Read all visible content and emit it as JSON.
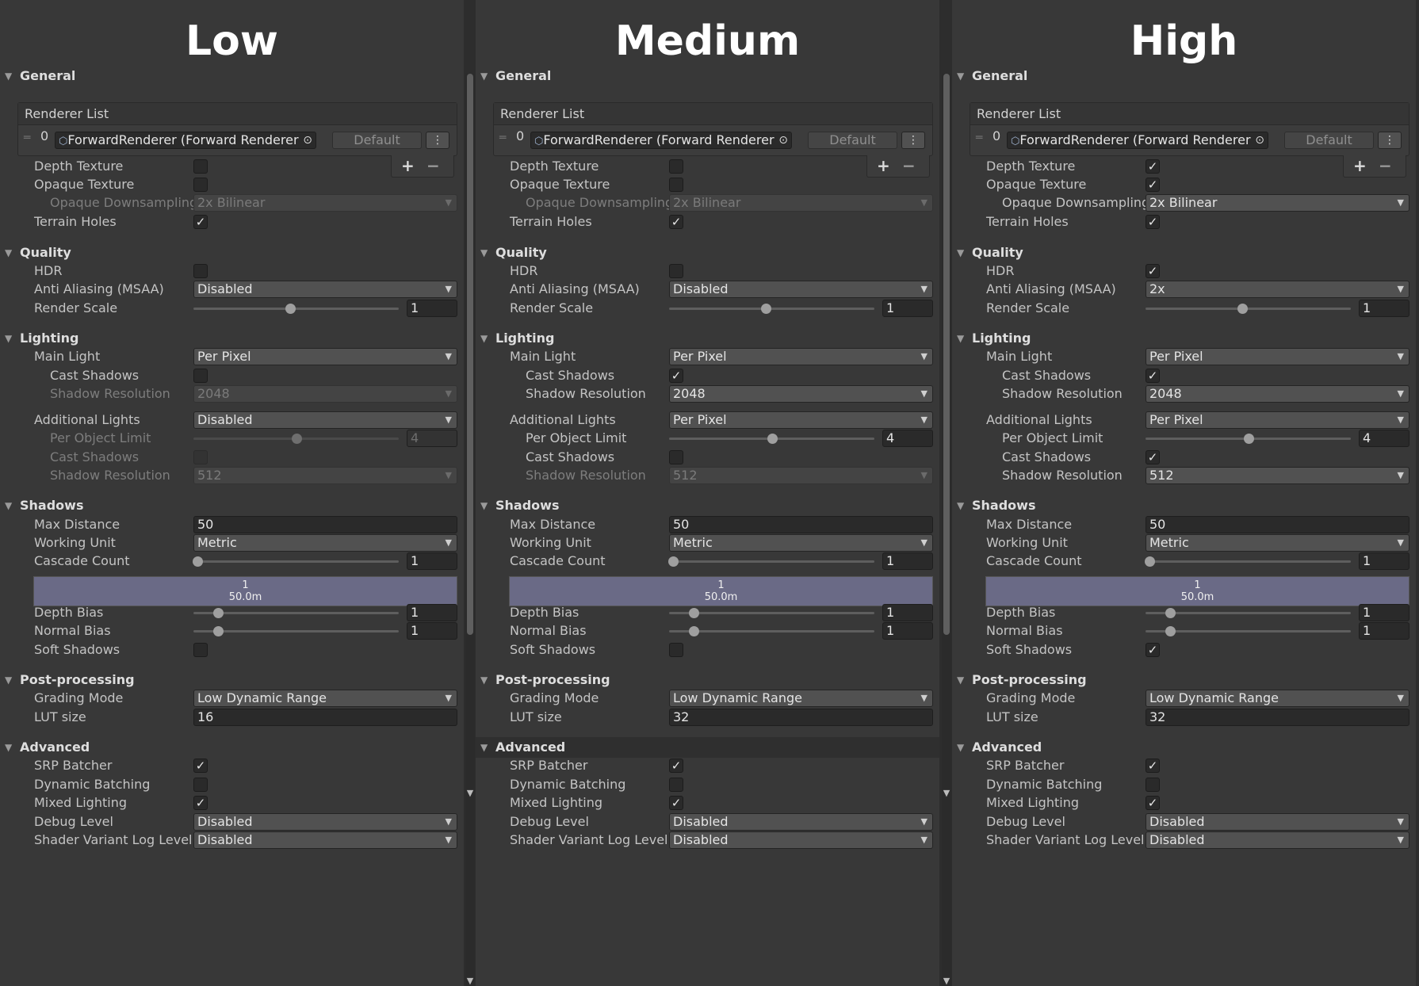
{
  "columns": [
    {
      "title": "Low",
      "renderer": {
        "header": "Renderer List",
        "index": "0",
        "object": "ForwardRenderer (Forward Renderer Da",
        "default_label": "Default",
        "menu_icon": "kebab-menu-icon",
        "add": "+",
        "remove": "−"
      },
      "sections": {
        "general": "General",
        "quality": "Quality",
        "lighting": "Lighting",
        "shadows": "Shadows",
        "postprocessing": "Post-processing",
        "advanced": "Advanced"
      },
      "labels": {
        "depth_texture": "Depth Texture",
        "opaque_texture": "Opaque Texture",
        "opaque_downsampling": "Opaque Downsampling",
        "terrain_holes": "Terrain Holes",
        "hdr": "HDR",
        "anti_aliasing": "Anti Aliasing (MSAA)",
        "render_scale": "Render Scale",
        "main_light": "Main Light",
        "cast_shadows": "Cast Shadows",
        "shadow_resolution": "Shadow Resolution",
        "additional_lights": "Additional Lights",
        "per_object_limit": "Per Object Limit",
        "max_distance": "Max Distance",
        "working_unit": "Working Unit",
        "cascade_count": "Cascade Count",
        "depth_bias": "Depth Bias",
        "normal_bias": "Normal Bias",
        "soft_shadows": "Soft Shadows",
        "grading_mode": "Grading Mode",
        "lut_size": "LUT size",
        "srp_batcher": "SRP Batcher",
        "dynamic_batching": "Dynamic Batching",
        "mixed_lighting": "Mixed Lighting",
        "debug_level": "Debug Level",
        "shader_variant_log": "Shader Variant Log Level"
      },
      "values": {
        "depth_texture": false,
        "opaque_texture": false,
        "opaque_downsampling": "2x Bilinear",
        "terrain_holes": true,
        "hdr": false,
        "anti_aliasing": "Disabled",
        "render_scale": "1",
        "render_scale_fraction": 0.47,
        "main_light": "Per Pixel",
        "main_cast_shadows": false,
        "main_shadow_resolution": "2048",
        "additional_lights": "Disabled",
        "per_object_limit": "4",
        "per_object_limit_fraction": 0.5,
        "add_cast_shadows": false,
        "add_shadow_resolution": "512",
        "max_distance": "50",
        "working_unit": "Metric",
        "cascade_count": "1",
        "cascade_fraction": 0.02,
        "cascade_index": "1",
        "cascade_distance": "50.0m",
        "depth_bias": "1",
        "depth_bias_fraction": 0.12,
        "normal_bias": "1",
        "normal_bias_fraction": 0.12,
        "soft_shadows": false,
        "grading_mode": "Low Dynamic Range",
        "lut_size": "16",
        "srp_batcher": true,
        "dynamic_batching": false,
        "mixed_lighting": true,
        "debug_level": "Disabled",
        "shader_variant_log": "Disabled"
      }
    },
    {
      "title": "Medium",
      "renderer": {
        "header": "Renderer List",
        "index": "0",
        "object": "ForwardRenderer (Forward Renderer Da",
        "default_label": "Default",
        "menu_icon": "kebab-menu-icon",
        "add": "+",
        "remove": "−"
      },
      "sections": {
        "general": "General",
        "quality": "Quality",
        "lighting": "Lighting",
        "shadows": "Shadows",
        "postprocessing": "Post-processing",
        "advanced": "Advanced"
      },
      "labels": {
        "depth_texture": "Depth Texture",
        "opaque_texture": "Opaque Texture",
        "opaque_downsampling": "Opaque Downsampling",
        "terrain_holes": "Terrain Holes",
        "hdr": "HDR",
        "anti_aliasing": "Anti Aliasing (MSAA)",
        "render_scale": "Render Scale",
        "main_light": "Main Light",
        "cast_shadows": "Cast Shadows",
        "shadow_resolution": "Shadow Resolution",
        "additional_lights": "Additional Lights",
        "per_object_limit": "Per Object Limit",
        "max_distance": "Max Distance",
        "working_unit": "Working Unit",
        "cascade_count": "Cascade Count",
        "depth_bias": "Depth Bias",
        "normal_bias": "Normal Bias",
        "soft_shadows": "Soft Shadows",
        "grading_mode": "Grading Mode",
        "lut_size": "LUT size",
        "srp_batcher": "SRP Batcher",
        "dynamic_batching": "Dynamic Batching",
        "mixed_lighting": "Mixed Lighting",
        "debug_level": "Debug Level",
        "shader_variant_log": "Shader Variant Log Level"
      },
      "values": {
        "depth_texture": false,
        "opaque_texture": false,
        "opaque_downsampling": "2x Bilinear",
        "terrain_holes": true,
        "hdr": false,
        "anti_aliasing": "Disabled",
        "render_scale": "1",
        "render_scale_fraction": 0.47,
        "main_light": "Per Pixel",
        "main_cast_shadows": true,
        "main_shadow_resolution": "2048",
        "additional_lights": "Per Pixel",
        "per_object_limit": "4",
        "per_object_limit_fraction": 0.5,
        "add_cast_shadows": false,
        "add_shadow_resolution": "512",
        "max_distance": "50",
        "working_unit": "Metric",
        "cascade_count": "1",
        "cascade_fraction": 0.02,
        "cascade_index": "1",
        "cascade_distance": "50.0m",
        "depth_bias": "1",
        "depth_bias_fraction": 0.12,
        "normal_bias": "1",
        "normal_bias_fraction": 0.12,
        "soft_shadows": false,
        "grading_mode": "Low Dynamic Range",
        "lut_size": "32",
        "srp_batcher": true,
        "dynamic_batching": false,
        "mixed_lighting": true,
        "debug_level": "Disabled",
        "shader_variant_log": "Disabled"
      }
    },
    {
      "title": "High",
      "renderer": {
        "header": "Renderer List",
        "index": "0",
        "object": "ForwardRenderer (Forward Renderer Da",
        "default_label": "Default",
        "menu_icon": "kebab-menu-icon",
        "add": "+",
        "remove": "−"
      },
      "sections": {
        "general": "General",
        "quality": "Quality",
        "lighting": "Lighting",
        "shadows": "Shadows",
        "postprocessing": "Post-processing",
        "advanced": "Advanced"
      },
      "labels": {
        "depth_texture": "Depth Texture",
        "opaque_texture": "Opaque Texture",
        "opaque_downsampling": "Opaque Downsampling",
        "terrain_holes": "Terrain Holes",
        "hdr": "HDR",
        "anti_aliasing": "Anti Aliasing (MSAA)",
        "render_scale": "Render Scale",
        "main_light": "Main Light",
        "cast_shadows": "Cast Shadows",
        "shadow_resolution": "Shadow Resolution",
        "additional_lights": "Additional Lights",
        "per_object_limit": "Per Object Limit",
        "max_distance": "Max Distance",
        "working_unit": "Working Unit",
        "cascade_count": "Cascade Count",
        "depth_bias": "Depth Bias",
        "normal_bias": "Normal Bias",
        "soft_shadows": "Soft Shadows",
        "grading_mode": "Grading Mode",
        "lut_size": "LUT size",
        "srp_batcher": "SRP Batcher",
        "dynamic_batching": "Dynamic Batching",
        "mixed_lighting": "Mixed Lighting",
        "debug_level": "Debug Level",
        "shader_variant_log": "Shader Variant Log Level"
      },
      "values": {
        "depth_texture": true,
        "opaque_texture": true,
        "opaque_downsampling": "2x Bilinear",
        "terrain_holes": true,
        "hdr": true,
        "anti_aliasing": "2x",
        "render_scale": "1",
        "render_scale_fraction": 0.47,
        "main_light": "Per Pixel",
        "main_cast_shadows": true,
        "main_shadow_resolution": "2048",
        "additional_lights": "Per Pixel",
        "per_object_limit": "4",
        "per_object_limit_fraction": 0.5,
        "add_cast_shadows": true,
        "add_shadow_resolution": "512",
        "max_distance": "50",
        "working_unit": "Metric",
        "cascade_count": "1",
        "cascade_fraction": 0.02,
        "cascade_index": "1",
        "cascade_distance": "50.0m",
        "depth_bias": "1",
        "depth_bias_fraction": 0.12,
        "normal_bias": "1",
        "normal_bias_fraction": 0.12,
        "soft_shadows": true,
        "grading_mode": "Low Dynamic Range",
        "lut_size": "32",
        "srp_batcher": true,
        "dynamic_batching": false,
        "mixed_lighting": true,
        "debug_level": "Disabled",
        "shader_variant_log": "Disabled"
      }
    }
  ],
  "icons": {
    "check": "✓",
    "dropdown_arrow": "▼",
    "foldout": "▼",
    "scroll_down": "▼",
    "handle": "═",
    "object_cube": "⬡",
    "picker": "⊙",
    "menu": "⋮"
  },
  "colors": {
    "background": "#383838",
    "title": "#ffffff",
    "cascade_bar": "#6a6a86",
    "field_dark": "#2a2a2a",
    "dropdown": "#515151"
  }
}
